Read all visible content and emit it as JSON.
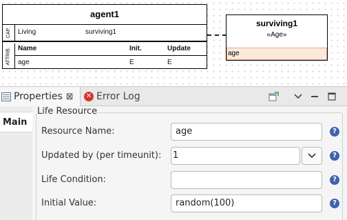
{
  "diagram": {
    "agent": {
      "title": "agent1",
      "cap_label": "CAP.",
      "capabilities": [
        {
          "name": "Living",
          "value": "surviving1"
        }
      ],
      "attr_label": "ATTRIB.",
      "attr_headers": {
        "name": "Name",
        "init": "Init.",
        "update": "Update"
      },
      "attributes": [
        {
          "name": "age",
          "init": "E",
          "update": "E"
        }
      ]
    },
    "resource": {
      "title": "surviving1",
      "stereotype": "«Age»",
      "attribute": "age"
    }
  },
  "tabs": {
    "properties": "Properties",
    "error_log": "Error Log"
  },
  "side_tabs": {
    "main": "Main"
  },
  "form": {
    "group_title": "Life Resource",
    "resource_name": {
      "label": "Resource Name:",
      "value": "age"
    },
    "updated_by": {
      "label": "Updated by (per timeunit):",
      "value": "1"
    },
    "life_condition": {
      "label": "Life Condition:",
      "value": ""
    },
    "initial_value": {
      "label": "Initial Value:",
      "value": "random(100)"
    }
  },
  "colors": {
    "help_icon": "#3f61b2",
    "error_icon": "#d9342b",
    "selected_row": "#fbe9dc"
  }
}
